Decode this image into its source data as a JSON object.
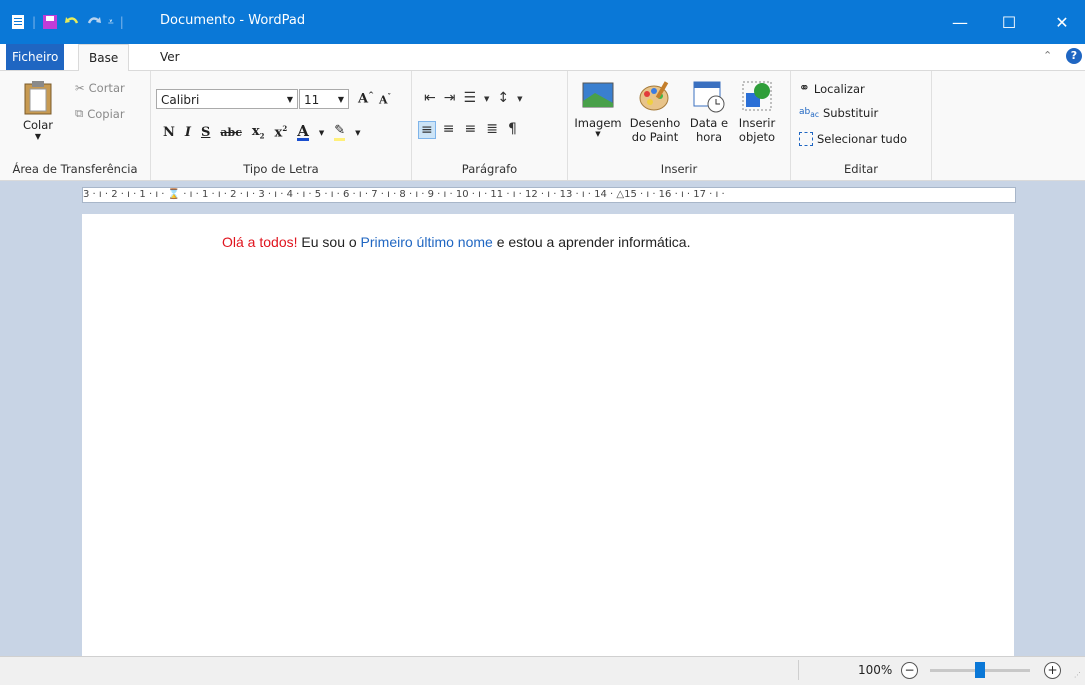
{
  "window": {
    "title": "Documento - WordPad"
  },
  "tabs": {
    "file": "Ficheiro",
    "base": "Base",
    "view": "Ver"
  },
  "clipboard": {
    "paste": "Colar",
    "cut": "Cortar",
    "copy": "Copiar",
    "label": "Área de Transferência"
  },
  "font": {
    "family": "Calibri",
    "size": "11",
    "label": "Tipo de Letra",
    "bold": "N",
    "italic": "I",
    "underline": "S",
    "strike": "abc"
  },
  "paragraph": {
    "label": "Parágrafo"
  },
  "insert": {
    "image": "Imagem",
    "paint_line1": "Desenho",
    "paint_line2": "do Paint",
    "datetime_line1": "Data e",
    "datetime_line2": "hora",
    "object_line1": "Inserir",
    "object_line2": "objeto",
    "label": "Inserir"
  },
  "edit": {
    "find": "Localizar",
    "replace": "Substituir",
    "select_all": "Selecionar tudo",
    "label": "Editar"
  },
  "ruler": {
    "text": "3 · ı · 2 · ı · 1 · ı · ⌛ · ı · 1 · ı · 2 · ı · 3 · ı · 4 · ı · 5 · ı · 6 · ı · 7 · ı · 8 · ı · 9 · ı · 10 · ı · 11 · ı · 12 · ı · 13 · ı · 14 · △15 · ı · 16 · ı · 17 · ı ·"
  },
  "document": {
    "part1": "Olá a todos!",
    "part2": " Eu sou o ",
    "part3": "Primeiro último nome",
    "part4": " e estou a aprender informática."
  },
  "status": {
    "zoom": "100%",
    "zoom_level_percent": 100
  },
  "colors": {
    "title_bar": "#0a78d7",
    "file_tab": "#1f66c2",
    "red_text": "#e0141e",
    "blue_text": "#1f66c2"
  }
}
